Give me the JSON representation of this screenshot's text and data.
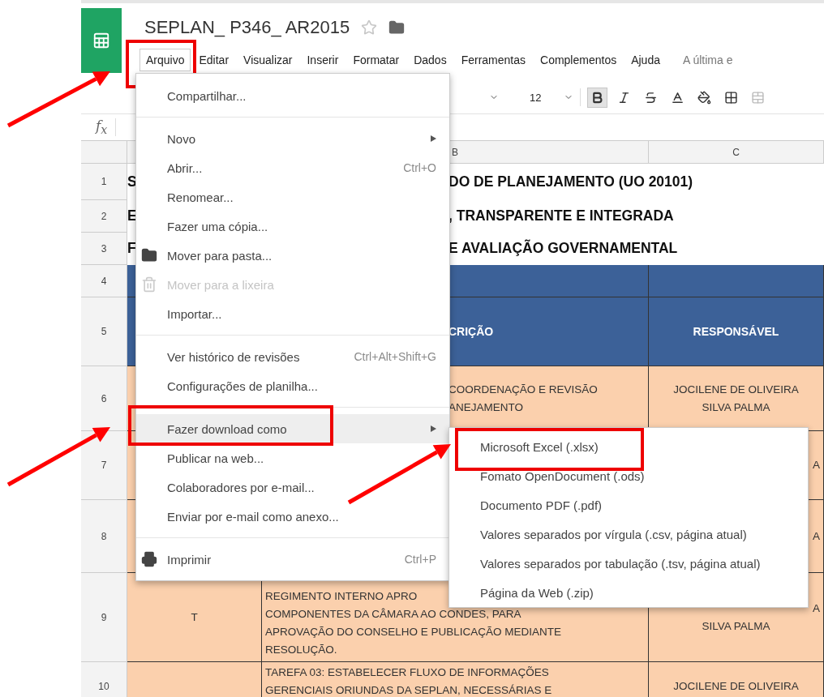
{
  "app": {
    "title": "SEPLAN_ P346_ AR2015",
    "starred": false
  },
  "menu_bar": [
    {
      "label": "Arquivo",
      "selected": true,
      "highlighted": true
    },
    {
      "label": "Editar",
      "selected": false,
      "highlighted": false
    },
    {
      "label": "Visualizar",
      "selected": false,
      "highlighted": false
    },
    {
      "label": "Inserir",
      "selected": false,
      "highlighted": false
    },
    {
      "label": "Formatar",
      "selected": false,
      "highlighted": false
    },
    {
      "label": "Dados",
      "selected": false,
      "highlighted": false
    },
    {
      "label": "Ferramentas",
      "selected": false,
      "highlighted": false
    },
    {
      "label": "Complementos",
      "selected": false,
      "highlighted": false
    },
    {
      "label": "Ajuda",
      "selected": false,
      "highlighted": false
    }
  ],
  "last_edit_notice": "A última e",
  "toolbar": {
    "font_size": "12",
    "buttons": [
      {
        "kind": "bold",
        "selected": true,
        "disabled": false
      },
      {
        "kind": "italic",
        "selected": false,
        "disabled": false
      },
      {
        "kind": "strikethrough",
        "selected": false,
        "disabled": false
      },
      {
        "kind": "text_color",
        "selected": false,
        "disabled": false
      },
      {
        "kind": "fill_color",
        "selected": false,
        "disabled": false
      },
      {
        "kind": "borders",
        "selected": false,
        "disabled": false
      },
      {
        "kind": "merge",
        "selected": false,
        "disabled": true
      }
    ]
  },
  "formula_bar": {
    "label": "f$_{x}$"
  },
  "column_headers": {
    "b": "B",
    "c": "C"
  },
  "rows": [
    {
      "number": "1",
      "kind": "title",
      "a": "S",
      "b": "DO DE PLANEJAMENTO (UO 20101)"
    },
    {
      "number": "2",
      "kind": "title",
      "a": "E",
      "b": ", TRANSPARENTE E INTEGRADA"
    },
    {
      "number": "3",
      "kind": "title",
      "a": "F",
      "b": "E AVALIAÇÃO GOVERNAMENTAL"
    },
    {
      "number": "4",
      "kind": "band"
    },
    {
      "number": "5",
      "kind": "header",
      "b": "CRIÇÃO",
      "c": [
        {
          "text": "RESPONSÁVEL",
          "partly_hidden": false
        }
      ]
    },
    {
      "number": "6",
      "kind": "task",
      "b_lines": [
        "COORDENAÇÃO E REVISÃO",
        "ANEJAMENTO"
      ],
      "c": [
        {
          "text": "JOCILENE DE OLIVEIRA",
          "partly_hidden": false
        },
        {
          "text": "SILVA PALMA",
          "partly_hidden": false
        }
      ]
    },
    {
      "number": "7",
      "kind": "task",
      "c": [
        {
          "text": "A",
          "partly_hidden": true
        }
      ]
    },
    {
      "number": "8",
      "kind": "task",
      "c": [
        {
          "text": "A",
          "partly_hidden": true
        }
      ]
    },
    {
      "number": "9",
      "kind": "long_task",
      "a": "T",
      "b_lines": [
        "REGIMENTO INTERNO APRO",
        "COMPONENTES DA CÂMARA AO CONDES, PARA",
        "APROVAÇÃO DO CONSELHO E PUBLICAÇÃO MEDIANTE",
        "RESOLUÇÃO."
      ],
      "c": [
        {
          "text": "A",
          "partly_hidden": true
        },
        {
          "text": "SILVA PALMA",
          "partly_hidden": false
        }
      ]
    },
    {
      "number": "10",
      "kind": "last_task",
      "b_lines": [
        "TAREFA 03: ESTABELECER FLUXO DE INFORMAÇÕES",
        "GERENCIAIS ORIUNDAS DA SEPLAN, NECESSÁRIAS E"
      ],
      "c": [
        {
          "text": "JOCILENE DE OLIVEIRA",
          "partly_hidden": false
        }
      ]
    }
  ],
  "file_menu": {
    "sections": [
      [
        {
          "label": "Compartilhar...",
          "kind": "plain",
          "disabled": false,
          "selected": false,
          "highlighted": false,
          "has_submenu": false
        }
      ],
      [
        {
          "label": "Novo",
          "kind": "plain",
          "disabled": false,
          "selected": false,
          "highlighted": false,
          "has_submenu": true
        },
        {
          "label": "Abrir...",
          "shortcut": "Ctrl+O",
          "kind": "plain",
          "disabled": false,
          "selected": false,
          "highlighted": false,
          "has_submenu": false
        },
        {
          "label": "Renomear...",
          "kind": "plain",
          "disabled": false,
          "selected": false,
          "highlighted": false,
          "has_submenu": false
        },
        {
          "label": "Fazer uma cópia...",
          "kind": "plain",
          "disabled": false,
          "selected": false,
          "highlighted": false,
          "has_submenu": false
        },
        {
          "label": "Mover para pasta...",
          "kind": "folder",
          "disabled": false,
          "selected": false,
          "highlighted": false,
          "has_submenu": false
        },
        {
          "label": "Mover para a lixeira",
          "kind": "trash",
          "disabled": true,
          "selected": false,
          "highlighted": false,
          "has_submenu": false
        },
        {
          "label": "Importar...",
          "kind": "plain",
          "disabled": false,
          "selected": false,
          "highlighted": false,
          "has_submenu": false
        }
      ],
      [
        {
          "label": "Ver histórico de revisões",
          "shortcut": "Ctrl+Alt+Shift+G",
          "kind": "plain",
          "disabled": false,
          "selected": false,
          "highlighted": false,
          "has_submenu": false
        },
        {
          "label": "Configurações de planilha...",
          "kind": "plain",
          "disabled": false,
          "selected": false,
          "highlighted": false,
          "has_submenu": false
        }
      ],
      [
        {
          "label": "Fazer download como",
          "kind": "plain",
          "disabled": false,
          "selected": true,
          "highlighted": true,
          "has_submenu": true
        },
        {
          "label": "Publicar na web...",
          "kind": "plain",
          "disabled": false,
          "selected": false,
          "highlighted": false,
          "has_submenu": false
        },
        {
          "label": "Colaboradores por e-mail...",
          "kind": "plain",
          "disabled": false,
          "selected": false,
          "highlighted": false,
          "has_submenu": false
        },
        {
          "label": "Enviar por e-mail como anexo...",
          "kind": "plain",
          "disabled": false,
          "selected": false,
          "highlighted": false,
          "has_submenu": false
        }
      ],
      [
        {
          "label": "Imprimir",
          "shortcut": "Ctrl+P",
          "kind": "printer",
          "disabled": false,
          "selected": false,
          "highlighted": false,
          "has_submenu": false
        }
      ]
    ]
  },
  "download_submenu": [
    {
      "label": "Microsoft Excel (.xlsx)",
      "highlighted": true
    },
    {
      "label": "Fomato OpenDocument (.ods)",
      "highlighted": false
    },
    {
      "label": "Documento PDF (.pdf)",
      "highlighted": false
    },
    {
      "label": "Valores separados por vírgula (.csv, página atual)",
      "highlighted": false
    },
    {
      "label": "Valores separados por tabulação (.tsv, página atual)",
      "highlighted": false
    },
    {
      "label": "Página da Web (.zip)",
      "highlighted": false
    }
  ]
}
